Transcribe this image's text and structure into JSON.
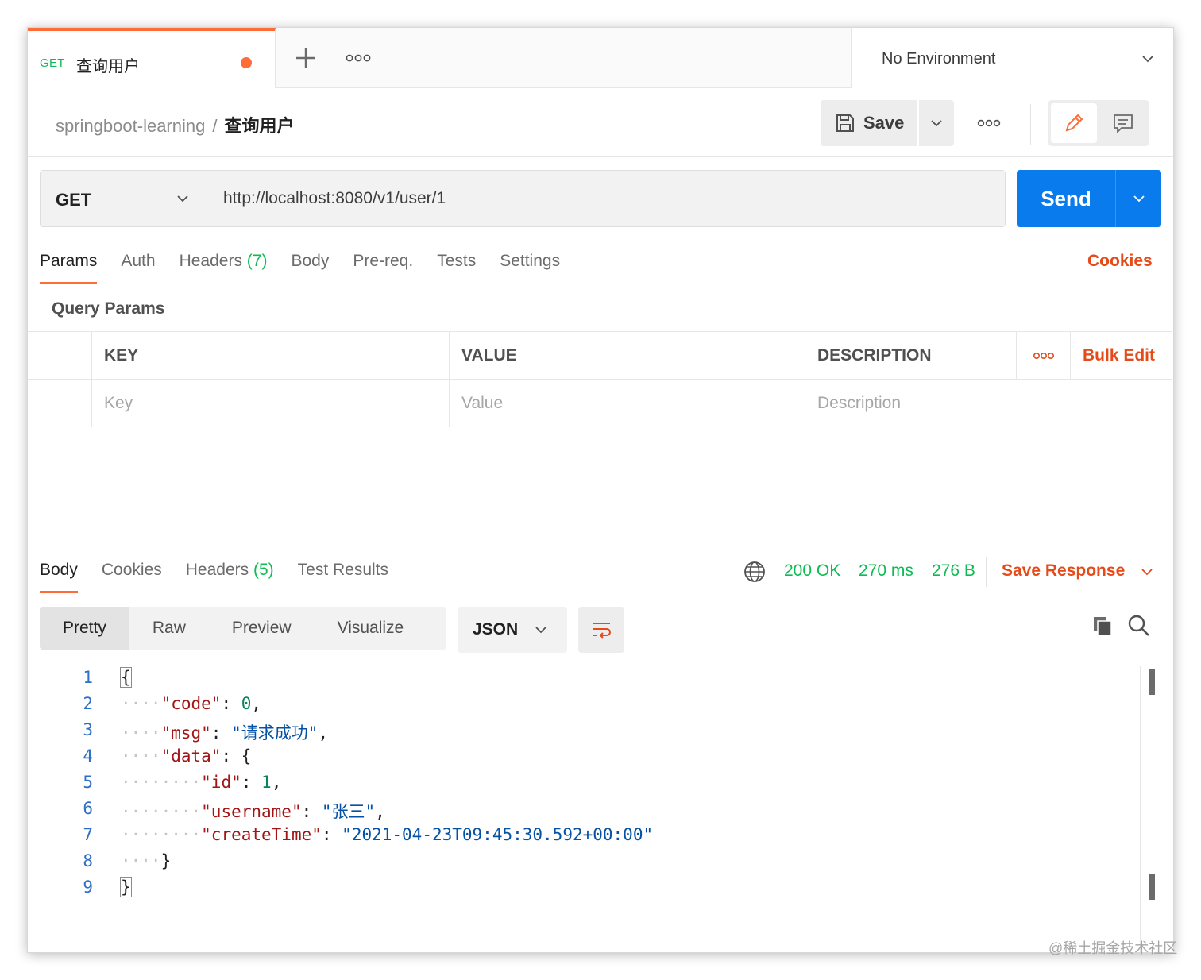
{
  "tabbar": {
    "tab_method": "GET",
    "tab_name": "查询用户",
    "environment": "No Environment"
  },
  "header": {
    "collection": "springboot-learning",
    "separator": "/",
    "request_name": "查询用户",
    "save_label": "Save"
  },
  "request": {
    "method": "GET",
    "url": "http://localhost:8080/v1/user/1",
    "send_label": "Send"
  },
  "request_tabs": [
    {
      "label": "Params",
      "count": ""
    },
    {
      "label": "Auth",
      "count": ""
    },
    {
      "label": "Headers ",
      "count": "(7)"
    },
    {
      "label": "Body",
      "count": ""
    },
    {
      "label": "Pre-req.",
      "count": ""
    },
    {
      "label": "Tests",
      "count": ""
    },
    {
      "label": "Settings",
      "count": ""
    }
  ],
  "cookies_link": "Cookies",
  "query_params": {
    "title": "Query Params",
    "columns": {
      "key": "KEY",
      "value": "VALUE",
      "description": "DESCRIPTION"
    },
    "bulk_edit": "Bulk Edit",
    "placeholders": {
      "key": "Key",
      "value": "Value",
      "description": "Description"
    }
  },
  "response_tabs": [
    {
      "label": "Body",
      "count": ""
    },
    {
      "label": "Cookies",
      "count": ""
    },
    {
      "label": "Headers ",
      "count": "(5)"
    },
    {
      "label": "Test Results",
      "count": ""
    }
  ],
  "response_status": {
    "status": "200 OK",
    "time": "270 ms",
    "size": "276 B",
    "save_response": "Save Response"
  },
  "view_modes": [
    "Pretty",
    "Raw",
    "Preview",
    "Visualize"
  ],
  "format": "JSON",
  "code_lines": [
    {
      "num": "1"
    },
    {
      "num": "2"
    },
    {
      "num": "3"
    },
    {
      "num": "4"
    },
    {
      "num": "5"
    },
    {
      "num": "6"
    },
    {
      "num": "7"
    },
    {
      "num": "8"
    },
    {
      "num": "9"
    }
  ],
  "response_body": {
    "code_key": "\"code\"",
    "code_val": "0",
    "msg_key": "\"msg\"",
    "msg_val": "\"请求成功\"",
    "data_key": "\"data\"",
    "id_key": "\"id\"",
    "id_val": "1",
    "username_key": "\"username\"",
    "username_val": "\"张三\"",
    "createTime_key": "\"createTime\"",
    "createTime_val": "\"2021-04-23T09:45:30.592+00:00\""
  },
  "watermark": "@稀土掘金技术社区",
  "colors": {
    "accent": "#ff6c37",
    "send": "#097bed",
    "success": "#0cbb52",
    "link": "#e64a19"
  }
}
